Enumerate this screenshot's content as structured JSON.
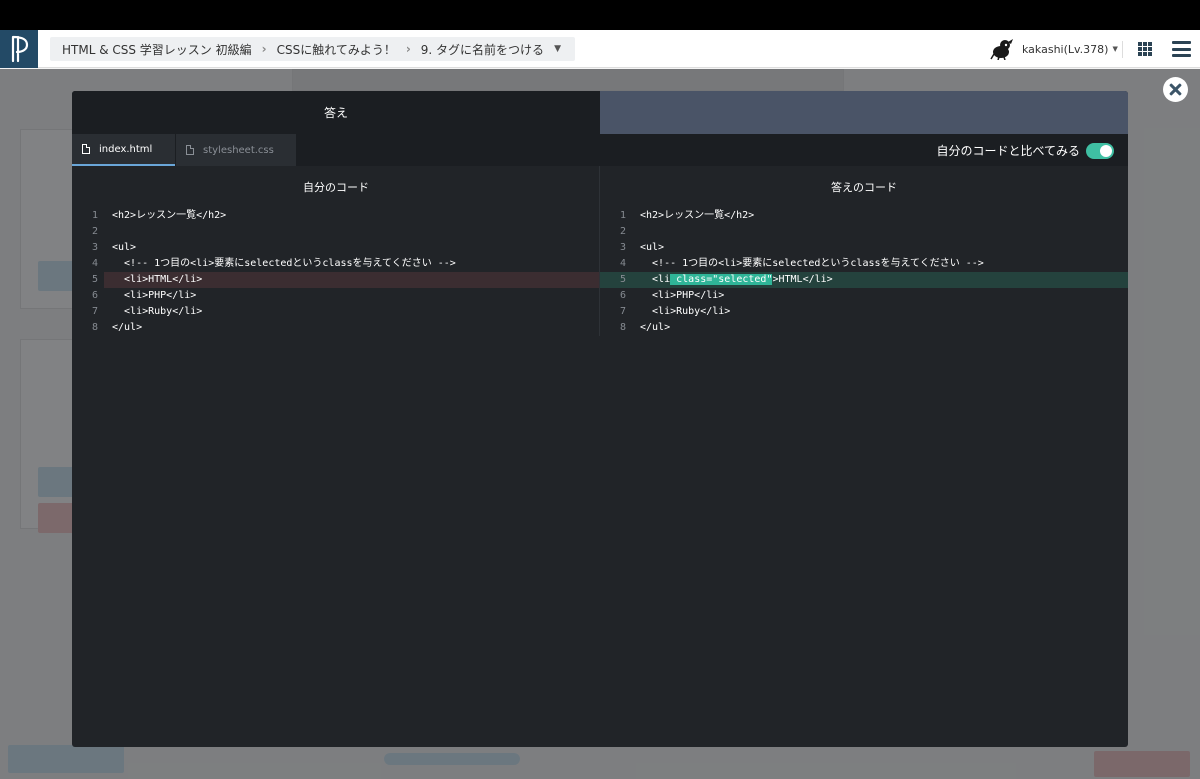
{
  "header": {
    "breadcrumb": [
      {
        "label": "HTML & CSS 学習レッスン 初級編"
      },
      {
        "label": "CSSに触れてみよう！"
      },
      {
        "label": "9. タグに名前をつける"
      }
    ],
    "user_name": "kakashi(Lv.378)"
  },
  "modal": {
    "title": "答え",
    "file_tabs": [
      {
        "label": "index.html",
        "active": true
      },
      {
        "label": "stylesheet.css",
        "active": false
      }
    ],
    "compare_label": "自分のコードと比べてみる",
    "compare_enabled": true,
    "my_code": {
      "title": "自分のコード",
      "lines": [
        {
          "num": "1",
          "text": "<h2>レッスン一覧</h2>",
          "state": "normal"
        },
        {
          "num": "2",
          "text": "",
          "state": "normal"
        },
        {
          "num": "3",
          "text": "<ul>",
          "state": "normal"
        },
        {
          "num": "4",
          "text": "  <!-- 1つ目の<li>要素にselectedというclassを与えてください -->",
          "state": "normal"
        },
        {
          "num": "5",
          "text": "  <li>HTML</li>",
          "state": "removed"
        },
        {
          "num": "6",
          "text": "  <li>PHP</li>",
          "state": "normal"
        },
        {
          "num": "7",
          "text": "  <li>Ruby</li>",
          "state": "normal"
        },
        {
          "num": "8",
          "text": "</ul>",
          "state": "normal"
        }
      ]
    },
    "answer_code": {
      "title": "答えのコード",
      "lines": [
        {
          "num": "1",
          "text": "<h2>レッスン一覧</h2>",
          "state": "normal"
        },
        {
          "num": "2",
          "text": "",
          "state": "normal"
        },
        {
          "num": "3",
          "text": "<ul>",
          "state": "normal"
        },
        {
          "num": "4",
          "text": "  <!-- 1つ目の<li>要素にselectedというclassを与えてください -->",
          "state": "normal"
        },
        {
          "num": "5",
          "pre": "  <li",
          "highlight": " class=\"selected\"",
          "post": ">HTML</li>",
          "state": "added"
        },
        {
          "num": "6",
          "text": "  <li>PHP</li>",
          "state": "normal"
        },
        {
          "num": "7",
          "text": "  <li>Ruby</li>",
          "state": "normal"
        },
        {
          "num": "8",
          "text": "</ul>",
          "state": "normal"
        }
      ]
    }
  },
  "colors": {
    "accent": "#3fbfa3",
    "logo_bg": "#234a66",
    "diff_removed": "#3b2d31",
    "diff_added": "#24423d"
  }
}
